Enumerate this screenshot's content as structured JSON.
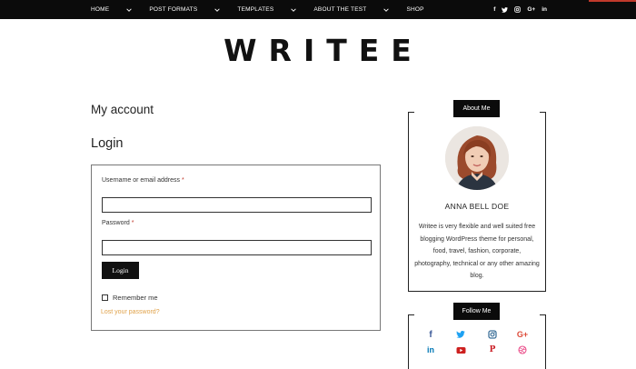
{
  "nav": {
    "items": [
      {
        "label": "HOME",
        "has_dropdown": true
      },
      {
        "label": "POST FORMATS",
        "has_dropdown": true
      },
      {
        "label": "TEMPLATES",
        "has_dropdown": true
      },
      {
        "label": "ABOUT THE TEST",
        "has_dropdown": true
      },
      {
        "label": "SHOP",
        "has_dropdown": false
      }
    ],
    "social": [
      {
        "icon": "facebook-icon",
        "glyph": "f"
      },
      {
        "icon": "twitter-icon",
        "glyph": "t"
      },
      {
        "icon": "instagram-icon",
        "glyph": "◎"
      },
      {
        "icon": "google-plus-icon",
        "glyph": "G+"
      },
      {
        "icon": "linkedin-icon",
        "glyph": "in"
      }
    ]
  },
  "site": {
    "logo": "WRITEE"
  },
  "page": {
    "title": "My account",
    "section_title": "Login"
  },
  "login_form": {
    "username_label": "Username or email address",
    "password_label": "Password",
    "required_mark": "*",
    "username_value": "",
    "password_value": "",
    "submit_label": "Login",
    "remember_label": "Remember me",
    "remember_checked": false,
    "lost_password_label": "Lost your password?"
  },
  "about_widget": {
    "title": "About Me",
    "name": "ANNA BELL DOE",
    "bio": "Writee is very flexible and well suited free blogging WordPress theme for personal, food, travel, fashion, corporate, photography, technical or any other amazing blog."
  },
  "follow_widget": {
    "title": "Follow Me",
    "icons": [
      {
        "icon": "facebook-icon",
        "glyph": "f",
        "color": "#3b5998"
      },
      {
        "icon": "twitter-icon",
        "glyph": "t",
        "color": "#1da1f2"
      },
      {
        "icon": "instagram-icon",
        "glyph": "◎",
        "color": "#3f729b"
      },
      {
        "icon": "google-plus-icon",
        "glyph": "G+",
        "color": "#dd4b39"
      },
      {
        "icon": "linkedin-icon",
        "glyph": "in",
        "color": "#0077b5"
      },
      {
        "icon": "youtube-icon",
        "glyph": "▶",
        "color": "#cd201f"
      },
      {
        "icon": "pinterest-icon",
        "glyph": "P",
        "color": "#cb2027"
      },
      {
        "icon": "dribbble-icon",
        "glyph": "◉",
        "color": "#ea4c89"
      }
    ]
  },
  "colors": {
    "topbar": "#0b0b0b",
    "accent": "#c0392b",
    "link": "#e0a24a",
    "required": "#c0392b"
  }
}
